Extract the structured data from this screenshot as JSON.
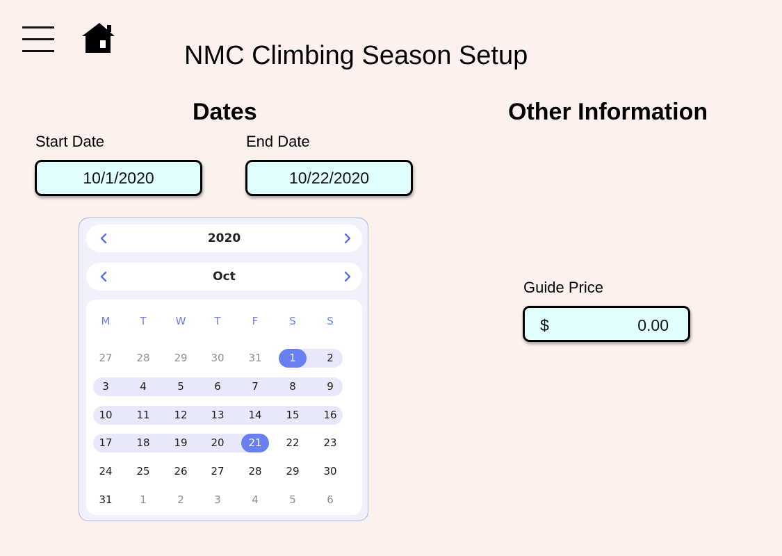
{
  "header": {
    "title": "NMC Climbing Season Setup",
    "menu_icon": "hamburger-menu-icon",
    "home_icon": "home-icon"
  },
  "dates": {
    "title": "Dates",
    "start_label": "Start Date",
    "start_value": "10/1/2020",
    "end_label": "End Date",
    "end_value": "10/22/2020"
  },
  "other": {
    "title": "Other Information",
    "guide_label": "Guide Price",
    "guide_currency": "$",
    "guide_value": "0.00"
  },
  "calendar": {
    "year": "2020",
    "month": "Oct",
    "weekdays": [
      "M",
      "T",
      "W",
      "T",
      "F",
      "S",
      "S"
    ],
    "weeks": [
      [
        "27",
        "28",
        "29",
        "30",
        "31",
        "1",
        "2"
      ],
      [
        "3",
        "4",
        "5",
        "6",
        "7",
        "8",
        "9"
      ],
      [
        "10",
        "11",
        "12",
        "13",
        "14",
        "15",
        "16"
      ],
      [
        "17",
        "18",
        "19",
        "20",
        "21",
        "22",
        "23"
      ],
      [
        "24",
        "25",
        "26",
        "27",
        "28",
        "29",
        "30"
      ],
      [
        "31",
        "1",
        "2",
        "3",
        "4",
        "5",
        "6"
      ]
    ],
    "selected_start": "1",
    "selected_end": "21",
    "accent_color": "#6a7ff2",
    "range_color": "#e7e9fb"
  },
  "colors": {
    "background": "#fdf1ee",
    "field_fill": "#e0fefe"
  }
}
